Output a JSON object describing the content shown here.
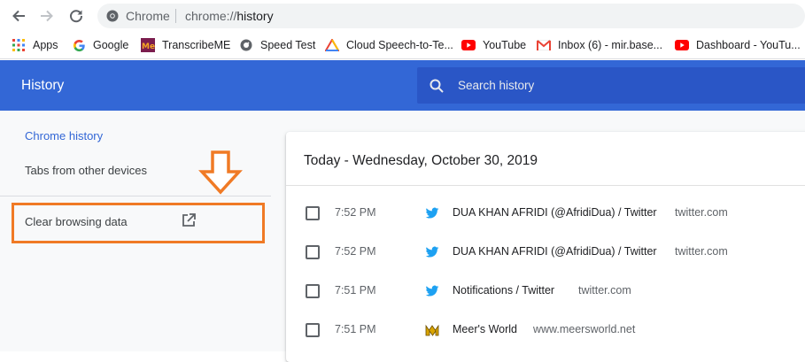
{
  "browser": {
    "site_label": "Chrome",
    "url_scheme": "chrome://",
    "url_path": "history"
  },
  "bookmarks": [
    {
      "label": "Apps",
      "icon": "apps-grid-icon"
    },
    {
      "label": "Google",
      "icon": "google-icon"
    },
    {
      "label": "TranscribeME",
      "icon": "transcribeme-icon"
    },
    {
      "label": "Speed Test",
      "icon": "speedtest-icon"
    },
    {
      "label": "Cloud Speech-to-Te...",
      "icon": "google-cloud-icon"
    },
    {
      "label": "YouTube",
      "icon": "youtube-icon"
    },
    {
      "label": "Inbox (6) - mir.base...",
      "icon": "gmail-icon"
    },
    {
      "label": "Dashboard - YouTu...",
      "icon": "youtube-icon"
    }
  ],
  "header": {
    "title": "History",
    "search_placeholder": "Search history"
  },
  "sidebar": {
    "chrome_history": "Chrome history",
    "tabs_other_devices": "Tabs from other devices",
    "clear_browsing_data": "Clear browsing data"
  },
  "history": {
    "day_title": "Today - Wednesday, October 30, 2019",
    "entries": [
      {
        "time": "7:52 PM",
        "title": "DUA KHAN AFRIDI (@AfridiDua) / Twitter",
        "domain": "twitter.com",
        "icon": "twitter-icon"
      },
      {
        "time": "7:52 PM",
        "title": "DUA KHAN AFRIDI (@AfridiDua) / Twitter",
        "domain": "twitter.com",
        "icon": "twitter-icon"
      },
      {
        "time": "7:51 PM",
        "title": "Notifications / Twitter",
        "domain": "twitter.com",
        "icon": "twitter-icon"
      },
      {
        "time": "7:51 PM",
        "title": "Meer's World",
        "domain": "www.meersworld.net",
        "icon": "meers-world-icon"
      }
    ]
  },
  "colors": {
    "header_blue": "#3367d6",
    "search_blue": "#2a56c6",
    "annotation_orange": "#f07a25",
    "twitter_blue": "#1da1f2"
  }
}
